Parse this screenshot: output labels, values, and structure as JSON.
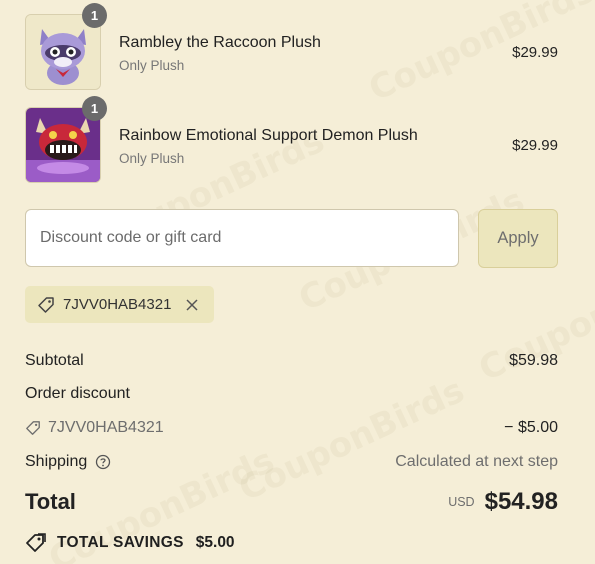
{
  "items": [
    {
      "name": "Rambley the Raccoon Plush",
      "variant": "Only Plush",
      "price": "$29.99",
      "quantity": "1",
      "thumb": "raccoon-plush"
    },
    {
      "name": "Rainbow Emotional Support Demon Plush",
      "variant": "Only Plush",
      "price": "$29.99",
      "quantity": "1",
      "thumb": "demon-plush"
    }
  ],
  "discount": {
    "placeholder": "Discount code or gift card",
    "apply_label": "Apply",
    "applied_code": "7JVV0HAB4321"
  },
  "summary": {
    "subtotal_label": "Subtotal",
    "subtotal_value": "$59.98",
    "order_discount_label": "Order discount",
    "discount_code": "7JVV0HAB4321",
    "discount_value": "− $5.00",
    "shipping_label": "Shipping",
    "shipping_value": "Calculated at next step",
    "total_label": "Total",
    "currency": "USD",
    "total_value": "$54.98",
    "savings_label": "TOTAL SAVINGS",
    "savings_value": "$5.00"
  },
  "colors": {
    "background": "#f5eed7",
    "apply_button": "#ece6bd",
    "chip": "#ece6bd",
    "badge": "#6b6b6b"
  }
}
